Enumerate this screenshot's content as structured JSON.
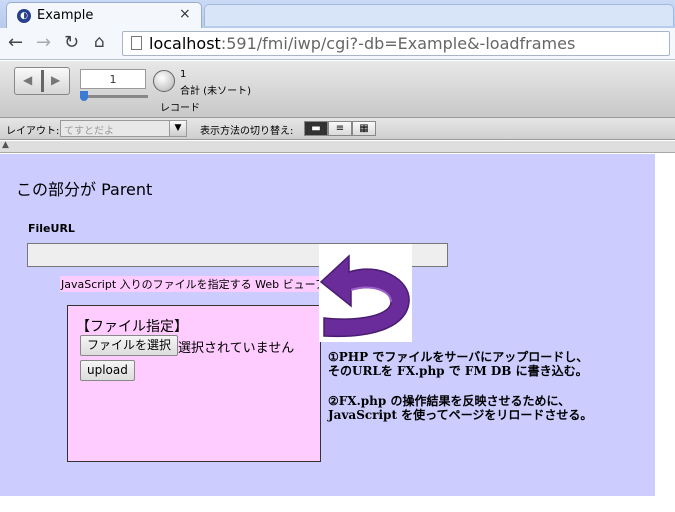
{
  "browser": {
    "tab_title": "Example",
    "tab_close": "×",
    "url_host": "localhost",
    "url_rest": ":591/fmi/iwp/cgi?-db=Example&-loadframes"
  },
  "toolbar": {
    "record_number": "1",
    "record_total": "1",
    "record_sort_status": "合計 (未ソート)",
    "records_label": "レコード"
  },
  "layoutbar": {
    "layout_label": "レイアウト:",
    "layout_value": "てすとだよ",
    "view_label": "表示方法の切り替え:"
  },
  "content": {
    "parent_title": "この部分が Parent",
    "fileurl_label": "FileURL",
    "webviewer_label": "JavaScript 入りのファイルを指定する Web ビューア",
    "file_box_title": "【ファイル指定】",
    "choose_file_button": "ファイルを選択",
    "no_file_text": "選択されていません",
    "upload_button": "upload",
    "note1_line1": "①PHP でファイルをサーバにアップロードし、",
    "note1_line2": "そのURLを FX.php で FM DB に書き込む。",
    "note2_line1": "②FX.php の操作結果を反映させるために、",
    "note2_line2": "JavaScript を使ってページをリロードさせる。"
  },
  "colors": {
    "content_bg": "#ccccff",
    "highlight_bg": "#ffccff",
    "arrow_purple": "#6a2c9a"
  }
}
